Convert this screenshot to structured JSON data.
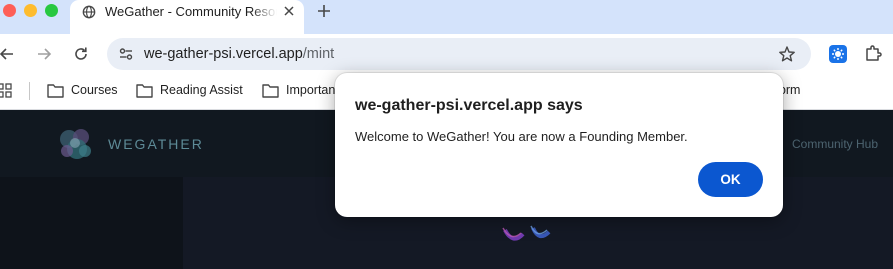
{
  "tab": {
    "title": "WeGather - Community Resources",
    "favicon": "globe-icon"
  },
  "omnibox": {
    "host": "we-gather-psi.vercel.app",
    "path": "/mint"
  },
  "bookmarks": [
    {
      "label": "Courses",
      "icon": "folder-icon"
    },
    {
      "label": "Reading Assist",
      "icon": "folder-icon"
    },
    {
      "label": "Importan",
      "icon": "folder-icon"
    }
  ],
  "bookmarks_right": {
    "label": "tform"
  },
  "site": {
    "brand": "WEGATHER",
    "nav_link": "Community Hub"
  },
  "dialog": {
    "title": "we-gather-psi.vercel.app says",
    "message": "Welcome to WeGather! You are now a Founding Member.",
    "ok_label": "OK"
  },
  "colors": {
    "tabbar": "#d4e3fb",
    "ok_button": "#0b57d0",
    "page_bg": "#0e131a",
    "brand": "#5d8a96"
  }
}
